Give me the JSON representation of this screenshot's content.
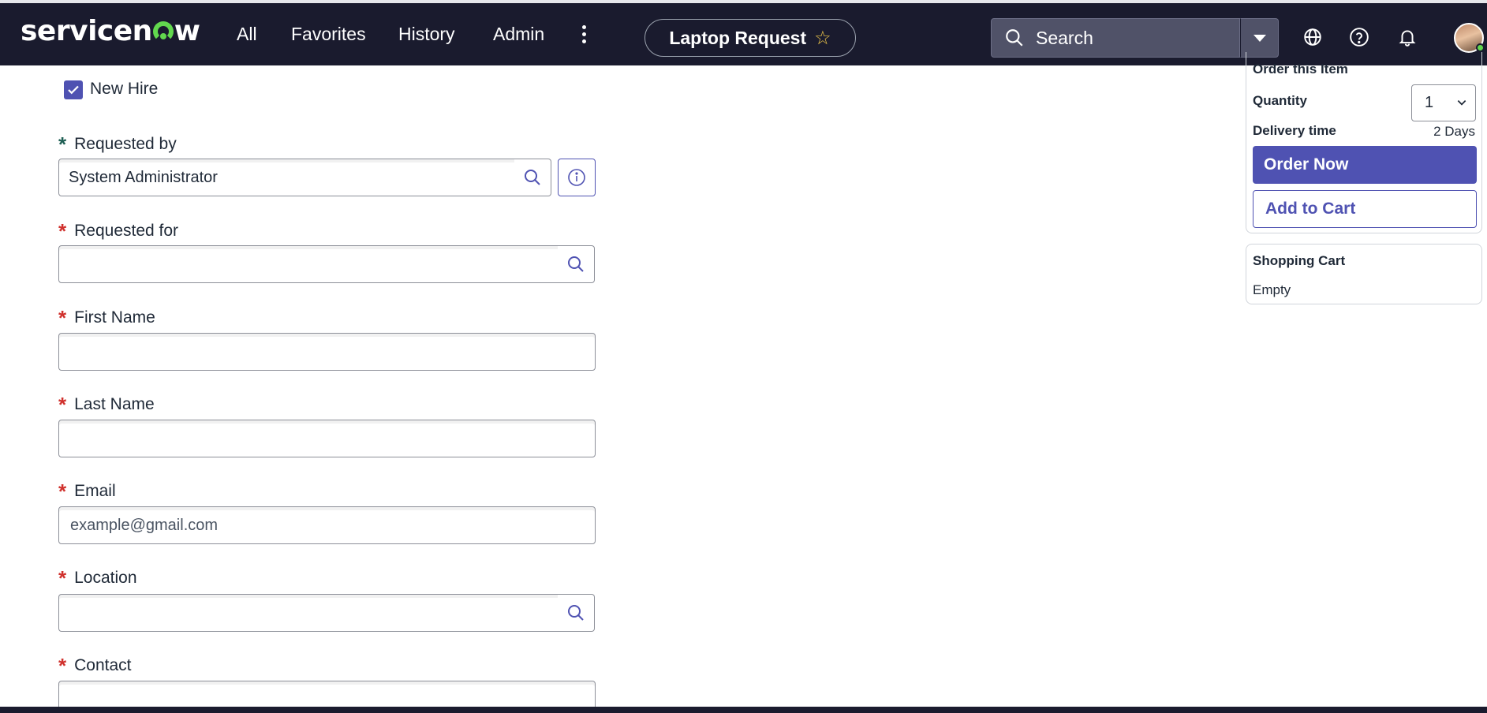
{
  "app": {
    "logo": "servicenow",
    "nav_links": [
      "All",
      "Favorites",
      "History",
      "Admin"
    ],
    "page_title": "Laptop Request",
    "search_placeholder": "Search"
  },
  "colors": {
    "nav_bg": "#1a1b2e",
    "accent": "#4f52b2",
    "required": "#d0312d",
    "favorite_star": "#f0c84a"
  },
  "icons": {
    "more": "kebab-vertical-icon",
    "favorite": "star-icon",
    "search": "search-icon",
    "dropdown": "caret-down-icon",
    "language": "globe-icon",
    "help": "help-icon",
    "notifications": "bell-icon",
    "lookup": "search-icon",
    "info": "info-icon"
  },
  "form": {
    "new_hire": {
      "label": "New Hire",
      "checked": true
    },
    "requested_by": {
      "label": "Requested by",
      "value": "System Administrator"
    },
    "requested_for": {
      "label": "Requested for",
      "value": ""
    },
    "first_name": {
      "label": "First Name",
      "value": ""
    },
    "last_name": {
      "label": "Last Name",
      "value": ""
    },
    "email": {
      "label": "Email",
      "placeholder": "example@gmail.com"
    },
    "location": {
      "label": "Location",
      "value": ""
    },
    "contact": {
      "label": "Contact",
      "value": ""
    }
  },
  "order": {
    "header": "Order this Item",
    "quantity_label": "Quantity",
    "quantity_value": "1",
    "delivery_label": "Delivery time",
    "delivery_value": "2 Days",
    "order_now": "Order Now",
    "add_to_cart": "Add to Cart"
  },
  "cart": {
    "header": "Shopping Cart",
    "status": "Empty"
  }
}
